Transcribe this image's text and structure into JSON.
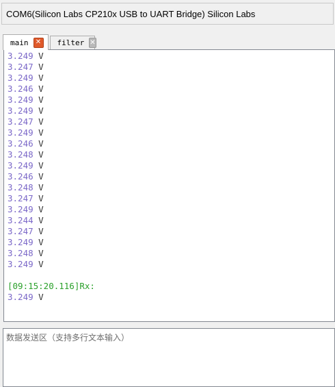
{
  "window": {
    "title": "COM6(Silicon Labs CP210x USB to UART Bridge) Silicon Labs"
  },
  "tabs": [
    {
      "label": "main",
      "close": "✕"
    },
    {
      "label": "filter",
      "close": "✕"
    }
  ],
  "console": {
    "unit": "V",
    "readings_block1": [
      "3.249",
      "3.247",
      "3.249",
      "3.246",
      "3.249",
      "3.249",
      "3.247",
      "3.249",
      "3.246",
      "3.248",
      "3.249",
      "3.246",
      "3.248",
      "3.247",
      "3.249",
      "3.244",
      "3.247",
      "3.249",
      "3.248",
      "3.249"
    ],
    "rx_header": "[09:15:20.116]Rx:",
    "readings_block2": [
      "3.249"
    ]
  },
  "send_area": {
    "placeholder": "数据发送区（支持多行文本输入）"
  }
}
